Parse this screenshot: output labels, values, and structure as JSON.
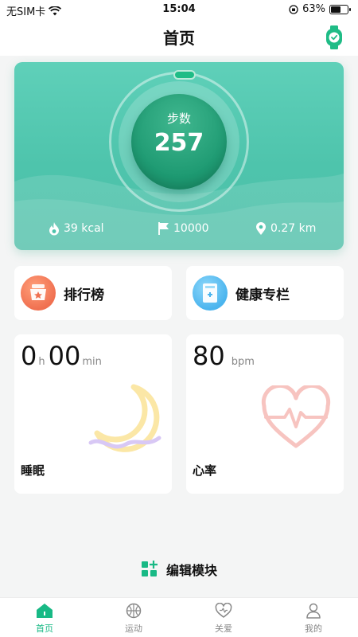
{
  "status": {
    "carrier": "无SIM卡",
    "time": "15:04",
    "battery": "63%",
    "battery_level": 0.63
  },
  "header": {
    "title": "首页",
    "right_icon": "smartwatch-icon"
  },
  "steps_card": {
    "label": "步数",
    "value": "257",
    "calories": "39 kcal",
    "goal": "10000",
    "distance": "0.27 km",
    "colors": {
      "card": "#4ec4ac",
      "core": "#1e9a72",
      "progress": "#1fbc86"
    }
  },
  "shortcuts": [
    {
      "title": "排行榜",
      "icon": "ranking-badge-icon"
    },
    {
      "title": "健康专栏",
      "icon": "health-column-icon"
    }
  ],
  "sleep": {
    "hours": "0",
    "hours_unit": "h",
    "minutes": "00",
    "minutes_unit": "min",
    "label": "睡眠",
    "icon": "moon-icon"
  },
  "heart": {
    "value": "80",
    "unit": "bpm",
    "label": "心率",
    "icon": "heartbeat-icon"
  },
  "edit": {
    "label": "编辑模块",
    "icon": "grid-edit-icon"
  },
  "tabbar": {
    "accent": "#18b985",
    "tabs": [
      {
        "label": "首页",
        "icon": "home-icon",
        "active": true
      },
      {
        "label": "运动",
        "icon": "basketball-icon",
        "active": false
      },
      {
        "label": "关爱",
        "icon": "heart-outline-icon",
        "active": false
      },
      {
        "label": "我的",
        "icon": "person-icon",
        "active": false
      }
    ]
  }
}
